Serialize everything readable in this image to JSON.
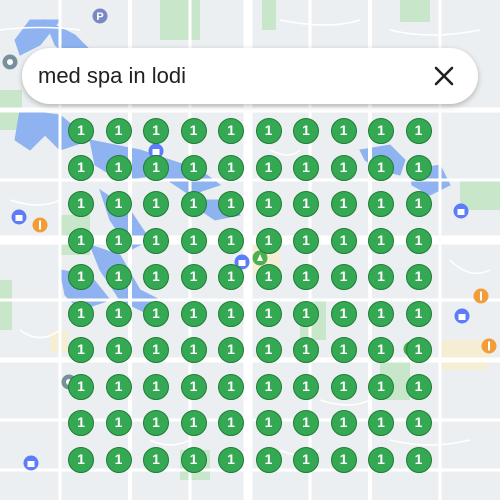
{
  "search": {
    "query": "med spa in lodi"
  },
  "icons": {
    "close": "close-icon",
    "poi_types": [
      "parking-icon",
      "shopping-icon",
      "restaurant-icon",
      "landmark-icon"
    ]
  },
  "colors": {
    "pin_fill": "#34a853",
    "pin_border": "#1e7e34",
    "water": "#6fa3e8",
    "park": "#c8e6c9",
    "road": "#ffffff",
    "land": "#eceff1"
  },
  "results": {
    "rows": 10,
    "cols": 10,
    "pin_label": "1"
  }
}
